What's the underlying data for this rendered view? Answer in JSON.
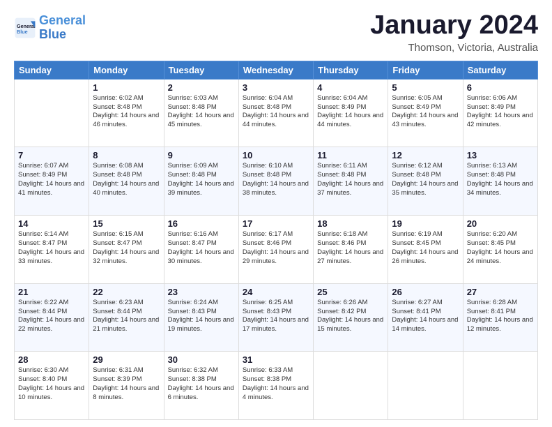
{
  "logo": {
    "line1": "General",
    "line2": "Blue"
  },
  "title": "January 2024",
  "subtitle": "Thomson, Victoria, Australia",
  "days_header": [
    "Sunday",
    "Monday",
    "Tuesday",
    "Wednesday",
    "Thursday",
    "Friday",
    "Saturday"
  ],
  "weeks": [
    [
      {
        "num": "",
        "sunrise": "",
        "sunset": "",
        "daylight": ""
      },
      {
        "num": "1",
        "sunrise": "Sunrise: 6:02 AM",
        "sunset": "Sunset: 8:48 PM",
        "daylight": "Daylight: 14 hours and 46 minutes."
      },
      {
        "num": "2",
        "sunrise": "Sunrise: 6:03 AM",
        "sunset": "Sunset: 8:48 PM",
        "daylight": "Daylight: 14 hours and 45 minutes."
      },
      {
        "num": "3",
        "sunrise": "Sunrise: 6:04 AM",
        "sunset": "Sunset: 8:48 PM",
        "daylight": "Daylight: 14 hours and 44 minutes."
      },
      {
        "num": "4",
        "sunrise": "Sunrise: 6:04 AM",
        "sunset": "Sunset: 8:49 PM",
        "daylight": "Daylight: 14 hours and 44 minutes."
      },
      {
        "num": "5",
        "sunrise": "Sunrise: 6:05 AM",
        "sunset": "Sunset: 8:49 PM",
        "daylight": "Daylight: 14 hours and 43 minutes."
      },
      {
        "num": "6",
        "sunrise": "Sunrise: 6:06 AM",
        "sunset": "Sunset: 8:49 PM",
        "daylight": "Daylight: 14 hours and 42 minutes."
      }
    ],
    [
      {
        "num": "7",
        "sunrise": "Sunrise: 6:07 AM",
        "sunset": "Sunset: 8:49 PM",
        "daylight": "Daylight: 14 hours and 41 minutes."
      },
      {
        "num": "8",
        "sunrise": "Sunrise: 6:08 AM",
        "sunset": "Sunset: 8:48 PM",
        "daylight": "Daylight: 14 hours and 40 minutes."
      },
      {
        "num": "9",
        "sunrise": "Sunrise: 6:09 AM",
        "sunset": "Sunset: 8:48 PM",
        "daylight": "Daylight: 14 hours and 39 minutes."
      },
      {
        "num": "10",
        "sunrise": "Sunrise: 6:10 AM",
        "sunset": "Sunset: 8:48 PM",
        "daylight": "Daylight: 14 hours and 38 minutes."
      },
      {
        "num": "11",
        "sunrise": "Sunrise: 6:11 AM",
        "sunset": "Sunset: 8:48 PM",
        "daylight": "Daylight: 14 hours and 37 minutes."
      },
      {
        "num": "12",
        "sunrise": "Sunrise: 6:12 AM",
        "sunset": "Sunset: 8:48 PM",
        "daylight": "Daylight: 14 hours and 35 minutes."
      },
      {
        "num": "13",
        "sunrise": "Sunrise: 6:13 AM",
        "sunset": "Sunset: 8:48 PM",
        "daylight": "Daylight: 14 hours and 34 minutes."
      }
    ],
    [
      {
        "num": "14",
        "sunrise": "Sunrise: 6:14 AM",
        "sunset": "Sunset: 8:47 PM",
        "daylight": "Daylight: 14 hours and 33 minutes."
      },
      {
        "num": "15",
        "sunrise": "Sunrise: 6:15 AM",
        "sunset": "Sunset: 8:47 PM",
        "daylight": "Daylight: 14 hours and 32 minutes."
      },
      {
        "num": "16",
        "sunrise": "Sunrise: 6:16 AM",
        "sunset": "Sunset: 8:47 PM",
        "daylight": "Daylight: 14 hours and 30 minutes."
      },
      {
        "num": "17",
        "sunrise": "Sunrise: 6:17 AM",
        "sunset": "Sunset: 8:46 PM",
        "daylight": "Daylight: 14 hours and 29 minutes."
      },
      {
        "num": "18",
        "sunrise": "Sunrise: 6:18 AM",
        "sunset": "Sunset: 8:46 PM",
        "daylight": "Daylight: 14 hours and 27 minutes."
      },
      {
        "num": "19",
        "sunrise": "Sunrise: 6:19 AM",
        "sunset": "Sunset: 8:45 PM",
        "daylight": "Daylight: 14 hours and 26 minutes."
      },
      {
        "num": "20",
        "sunrise": "Sunrise: 6:20 AM",
        "sunset": "Sunset: 8:45 PM",
        "daylight": "Daylight: 14 hours and 24 minutes."
      }
    ],
    [
      {
        "num": "21",
        "sunrise": "Sunrise: 6:22 AM",
        "sunset": "Sunset: 8:44 PM",
        "daylight": "Daylight: 14 hours and 22 minutes."
      },
      {
        "num": "22",
        "sunrise": "Sunrise: 6:23 AM",
        "sunset": "Sunset: 8:44 PM",
        "daylight": "Daylight: 14 hours and 21 minutes."
      },
      {
        "num": "23",
        "sunrise": "Sunrise: 6:24 AM",
        "sunset": "Sunset: 8:43 PM",
        "daylight": "Daylight: 14 hours and 19 minutes."
      },
      {
        "num": "24",
        "sunrise": "Sunrise: 6:25 AM",
        "sunset": "Sunset: 8:43 PM",
        "daylight": "Daylight: 14 hours and 17 minutes."
      },
      {
        "num": "25",
        "sunrise": "Sunrise: 6:26 AM",
        "sunset": "Sunset: 8:42 PM",
        "daylight": "Daylight: 14 hours and 15 minutes."
      },
      {
        "num": "26",
        "sunrise": "Sunrise: 6:27 AM",
        "sunset": "Sunset: 8:41 PM",
        "daylight": "Daylight: 14 hours and 14 minutes."
      },
      {
        "num": "27",
        "sunrise": "Sunrise: 6:28 AM",
        "sunset": "Sunset: 8:41 PM",
        "daylight": "Daylight: 14 hours and 12 minutes."
      }
    ],
    [
      {
        "num": "28",
        "sunrise": "Sunrise: 6:30 AM",
        "sunset": "Sunset: 8:40 PM",
        "daylight": "Daylight: 14 hours and 10 minutes."
      },
      {
        "num": "29",
        "sunrise": "Sunrise: 6:31 AM",
        "sunset": "Sunset: 8:39 PM",
        "daylight": "Daylight: 14 hours and 8 minutes."
      },
      {
        "num": "30",
        "sunrise": "Sunrise: 6:32 AM",
        "sunset": "Sunset: 8:38 PM",
        "daylight": "Daylight: 14 hours and 6 minutes."
      },
      {
        "num": "31",
        "sunrise": "Sunrise: 6:33 AM",
        "sunset": "Sunset: 8:38 PM",
        "daylight": "Daylight: 14 hours and 4 minutes."
      },
      {
        "num": "",
        "sunrise": "",
        "sunset": "",
        "daylight": ""
      },
      {
        "num": "",
        "sunrise": "",
        "sunset": "",
        "daylight": ""
      },
      {
        "num": "",
        "sunrise": "",
        "sunset": "",
        "daylight": ""
      }
    ]
  ]
}
